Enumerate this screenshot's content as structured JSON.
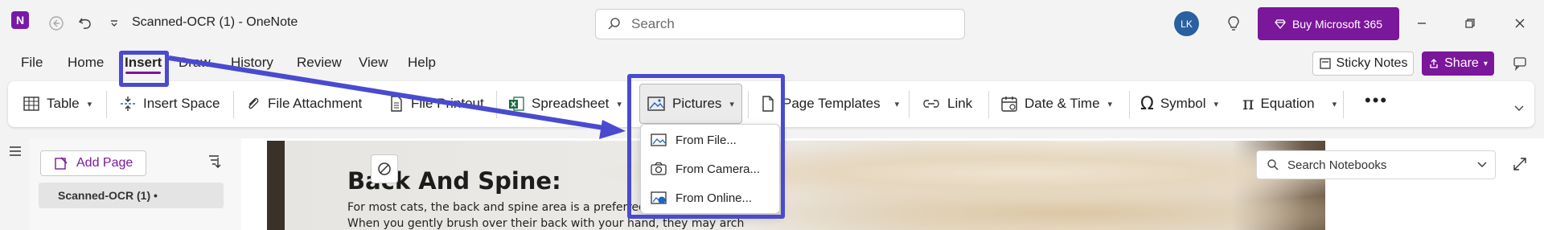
{
  "window": {
    "doc_title": "Scanned-OCR (1)  -  OneNote",
    "search_placeholder": "Search",
    "avatar_initials": "LK",
    "buy_label": "Buy Microsoft 365"
  },
  "menu": {
    "tabs": [
      "File",
      "Home",
      "Insert",
      "Draw",
      "History",
      "Review",
      "View",
      "Help"
    ],
    "active": "Insert",
    "sticky_notes": "Sticky Notes",
    "share": "Share"
  },
  "ribbon": {
    "items": [
      {
        "label": "Table",
        "icon": "table-icon"
      },
      {
        "label": "Insert Space",
        "icon": "insert-space-icon"
      },
      {
        "label": "File Attachment",
        "icon": "paperclip-icon"
      },
      {
        "label": "File Printout",
        "icon": "file-printout-icon"
      },
      {
        "label": "Spreadsheet",
        "icon": "excel-icon"
      },
      {
        "label": "Pictures",
        "icon": "picture-icon"
      },
      {
        "label": "Page Templates",
        "icon": "page-templates-icon"
      },
      {
        "label": "Link",
        "icon": "link-icon"
      },
      {
        "label": "Date & Time",
        "icon": "calendar-icon"
      },
      {
        "label": "Symbol",
        "icon": "omega-icon"
      },
      {
        "label": "Equation",
        "icon": "pi-icon"
      }
    ]
  },
  "pictures_menu": {
    "items": [
      "From File...",
      "From Camera...",
      "From Online..."
    ]
  },
  "left_nav": {
    "add_page": "Add Page",
    "page_title": "Scanned-OCR (1)  •"
  },
  "search_notebooks": "Search Notebooks",
  "page": {
    "heading": "Back And Spine:",
    "line1": "For most cats, the back and spine area is a preferred",
    "line2": "When you gently brush over their back with your hand, they may arch"
  },
  "colors": {
    "accent_purple": "#7b179b",
    "annotation_blue": "#4a4ad0"
  }
}
